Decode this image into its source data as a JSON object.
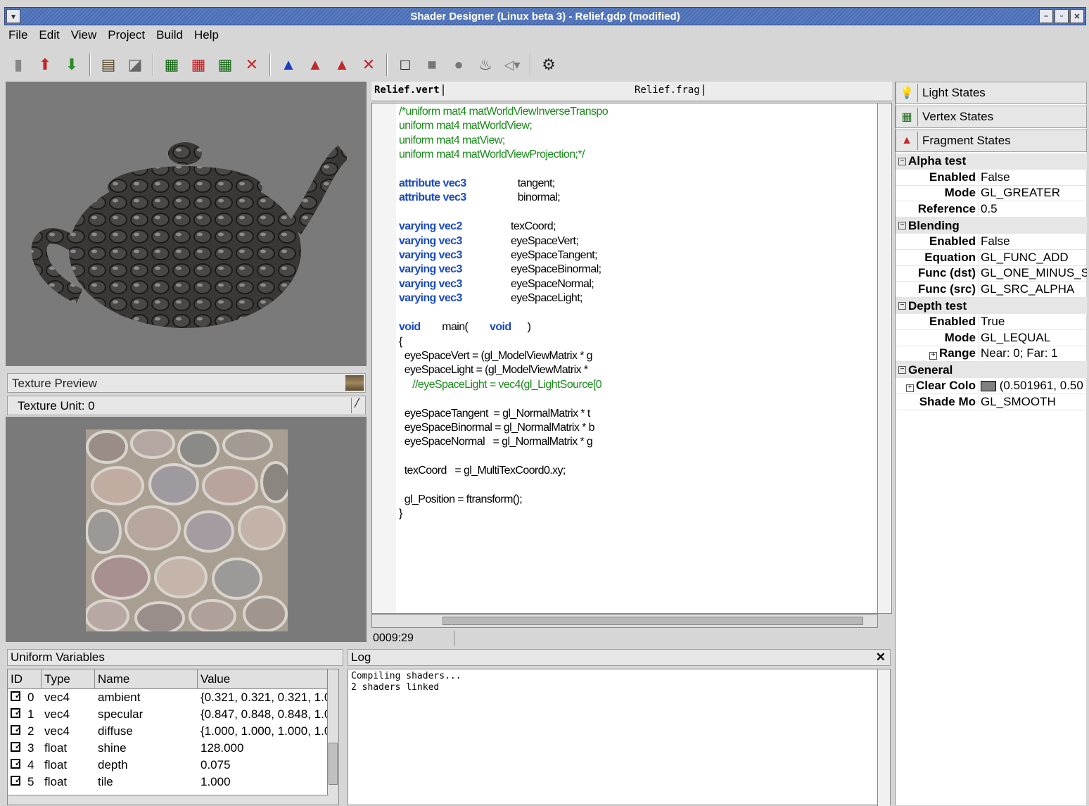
{
  "window": {
    "title": "Shader Designer (Linux beta 3) - Relief.gdp (modified)"
  },
  "menu": [
    "File",
    "Edit",
    "View",
    "Project",
    "Build",
    "Help"
  ],
  "texture_preview": {
    "title": "Texture Preview",
    "unit_label": "Texture Unit: 0"
  },
  "uniforms": {
    "title": "Uniform Variables",
    "columns": [
      "ID",
      "Type",
      "Name",
      "Value"
    ],
    "rows": [
      {
        "id": "0",
        "type": "vec4",
        "name": "ambient",
        "value": "{0.321, 0.321, 0.321, 1.00"
      },
      {
        "id": "1",
        "type": "vec4",
        "name": "specular",
        "value": "{0.847, 0.848, 0.848, 1.00"
      },
      {
        "id": "2",
        "type": "vec4",
        "name": "diffuse",
        "value": "{1.000, 1.000, 1.000, 1.00"
      },
      {
        "id": "3",
        "type": "float",
        "name": "shine",
        "value": "128.000"
      },
      {
        "id": "4",
        "type": "float",
        "name": "depth",
        "value": "0.075"
      },
      {
        "id": "5",
        "type": "float",
        "name": "tile",
        "value": "1.000"
      }
    ]
  },
  "editor": {
    "tab_vert": "Relief.vert",
    "tab_frag": "Relief.frag",
    "cursor": "0009:29"
  },
  "log": {
    "title": "Log",
    "text": "Compiling shaders...\n2 shaders linked"
  },
  "states": {
    "tab_light": "Light States",
    "tab_vertex": "Vertex States",
    "tab_fragment": "Fragment States",
    "alpha": {
      "title": "Alpha test",
      "enabled_k": "Enabled",
      "enabled_v": "False",
      "mode_k": "Mode",
      "mode_v": "GL_GREATER",
      "ref_k": "Reference",
      "ref_v": "0.5"
    },
    "blending": {
      "title": "Blending",
      "enabled_k": "Enabled",
      "enabled_v": "False",
      "eq_k": "Equation",
      "eq_v": "GL_FUNC_ADD",
      "dst_k": "Func (dst)",
      "dst_v": "GL_ONE_MINUS_S",
      "src_k": "Func (src)",
      "src_v": "GL_SRC_ALPHA"
    },
    "depth": {
      "title": "Depth test",
      "enabled_k": "Enabled",
      "enabled_v": "True",
      "mode_k": "Mode",
      "mode_v": "GL_LEQUAL",
      "range_k": "Range",
      "range_v": "Near: 0; Far: 1"
    },
    "general": {
      "title": "General",
      "clear_k": "Clear Colo",
      "clear_v": "(0.501961, 0.50",
      "shade_k": "Shade Mo",
      "shade_v": "GL_SMOOTH"
    }
  }
}
